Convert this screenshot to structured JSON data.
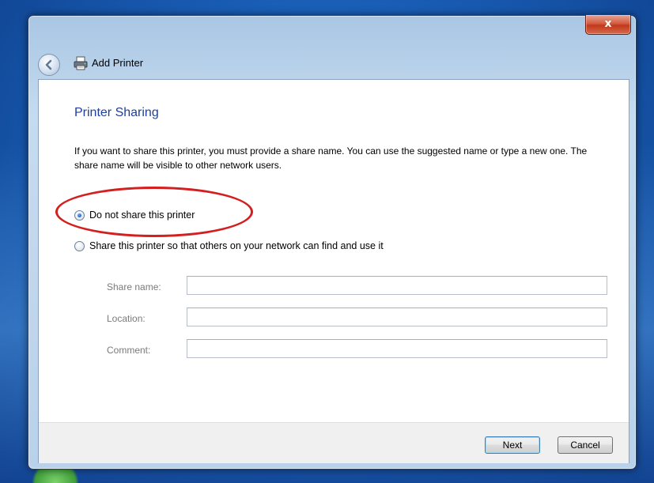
{
  "window": {
    "title": "Add Printer",
    "close_label": "x"
  },
  "page": {
    "heading": "Printer Sharing",
    "description": "If you want to share this printer, you must provide a share name. You can use the suggested name or type a new one. The share name will be visible to other network users."
  },
  "options": {
    "no_share": {
      "label": "Do not share this printer",
      "selected": true
    },
    "share": {
      "label": "Share this printer so that others on your network can find and use it",
      "selected": false
    }
  },
  "fields": {
    "share_name": {
      "label": "Share name:",
      "value": ""
    },
    "location": {
      "label": "Location:",
      "value": ""
    },
    "comment": {
      "label": "Comment:",
      "value": ""
    }
  },
  "buttons": {
    "next": "Next",
    "cancel": "Cancel"
  },
  "colors": {
    "heading": "#1e3f9b",
    "highlight": "#d41f1f",
    "close_button": "#c1391c"
  },
  "icons": [
    "back-arrow-icon",
    "printer-icon",
    "close-icon"
  ]
}
